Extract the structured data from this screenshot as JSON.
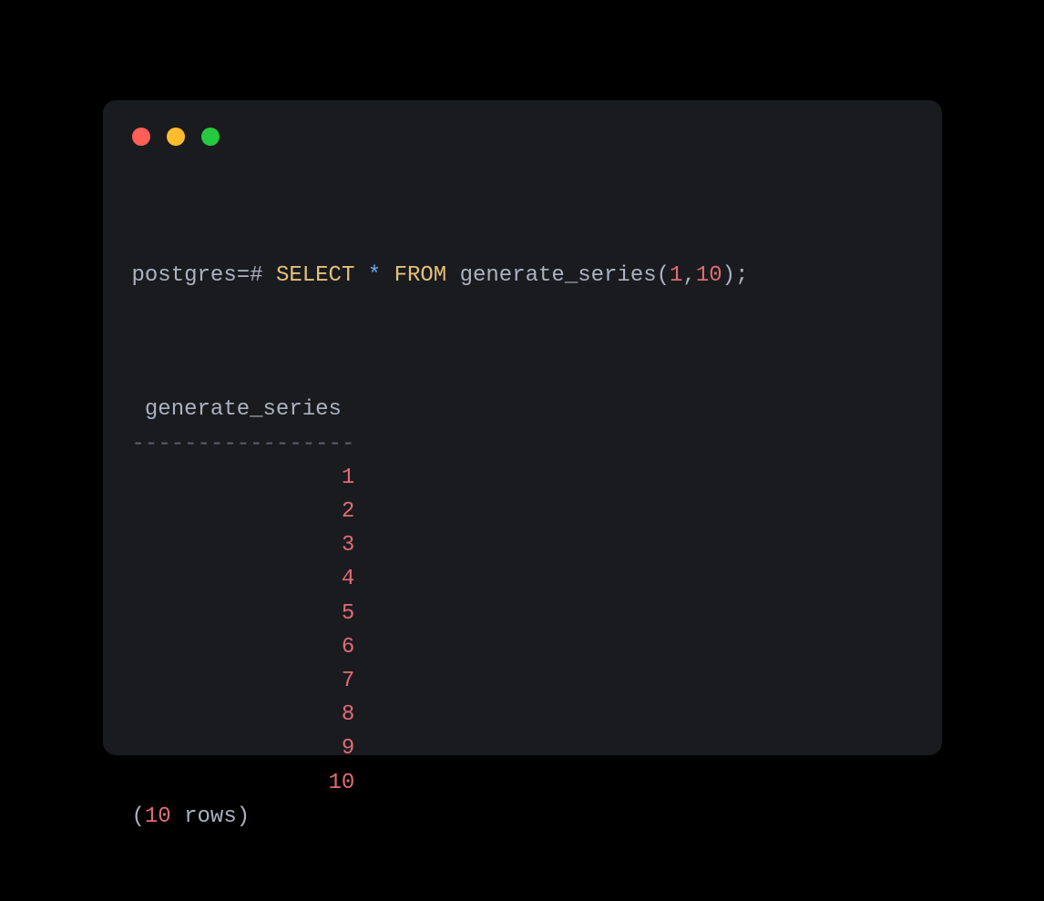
{
  "traffic_lights": {
    "red": "#ff5f56",
    "yellow": "#ffbd2e",
    "green": "#27c93f"
  },
  "command": {
    "prompt": "postgres=#",
    "select_kw": "SELECT",
    "star": "*",
    "from_kw": "FROM",
    "func_name": "generate_series",
    "open_paren": "(",
    "arg1": "1",
    "comma": ",",
    "arg2": "10",
    "close_paren": ")",
    "semicolon": ";"
  },
  "output": {
    "column_header": " generate_series ",
    "divider": "-----------------",
    "rows": [
      "1",
      "2",
      "3",
      "4",
      "5",
      "6",
      "7",
      "8",
      "9",
      "10"
    ],
    "footer_open": "(",
    "footer_count": "10",
    "footer_rows": " rows)"
  }
}
